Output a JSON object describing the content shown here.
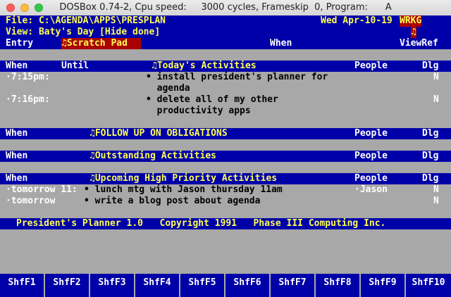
{
  "window": {
    "title": "DOSBox 0.74-2, Cpu speed:     3000 cycles, Frameskip  0, Program:      A"
  },
  "header": {
    "file": "File: C:\\AGENDA\\APPS\\PRESPLAN",
    "date": "Wed Apr-10-19",
    "mode": "WRKG",
    "view": "View: Baty's Day [Hide done]",
    "note_marker": "♫"
  },
  "toolbar": {
    "entry": "Entry",
    "scratch_pad": "♫Scratch Pad",
    "when": "When",
    "viewref": "ViewRef"
  },
  "sections": [
    {
      "when": "When",
      "until": "Until",
      "title": "♫Today's Activities",
      "people": "People",
      "dlg": "Dlg",
      "items": [
        {
          "when": "·7:15pm",
          "colon": ":",
          "lines": [
            "• install president's planner for",
            "  agenda"
          ],
          "people": "",
          "dlg": "N"
        },
        {
          "when": "·7:16pm",
          "colon": ":",
          "lines": [
            "• delete all of my other",
            "  productivity apps"
          ],
          "people": "",
          "dlg": "N"
        }
      ]
    },
    {
      "when": "When",
      "title": "♫FOLLOW UP ON OBLIGATIONS",
      "people": "People",
      "dlg": "Dlg",
      "items": []
    },
    {
      "when": "When",
      "title": "♫Outstanding Activities",
      "people": "People",
      "dlg": "Dlg",
      "items": []
    },
    {
      "when": "When",
      "title": "♫Upcoming High Priority Activities",
      "people": "People",
      "dlg": "Dlg",
      "items": [
        {
          "when": "·tomorrow 11:",
          "lines": [
            "• lunch mtg with Jason thursday 11am"
          ],
          "people": "·Jason",
          "dlg": "N"
        },
        {
          "when": "·tomorrow",
          "lines": [
            "• write a blog post about agenda"
          ],
          "people": "",
          "dlg": "N"
        }
      ]
    }
  ],
  "footer": "President's Planner 1.0   Copyright 1991   Phase III Computing Inc.",
  "fkeys": [
    "ShfF1",
    "ShfF2",
    "ShfF3",
    "ShfF4",
    "ShfF5",
    "ShfF6",
    "ShfF7",
    "ShfF8",
    "ShfF9",
    "ShfF10"
  ]
}
